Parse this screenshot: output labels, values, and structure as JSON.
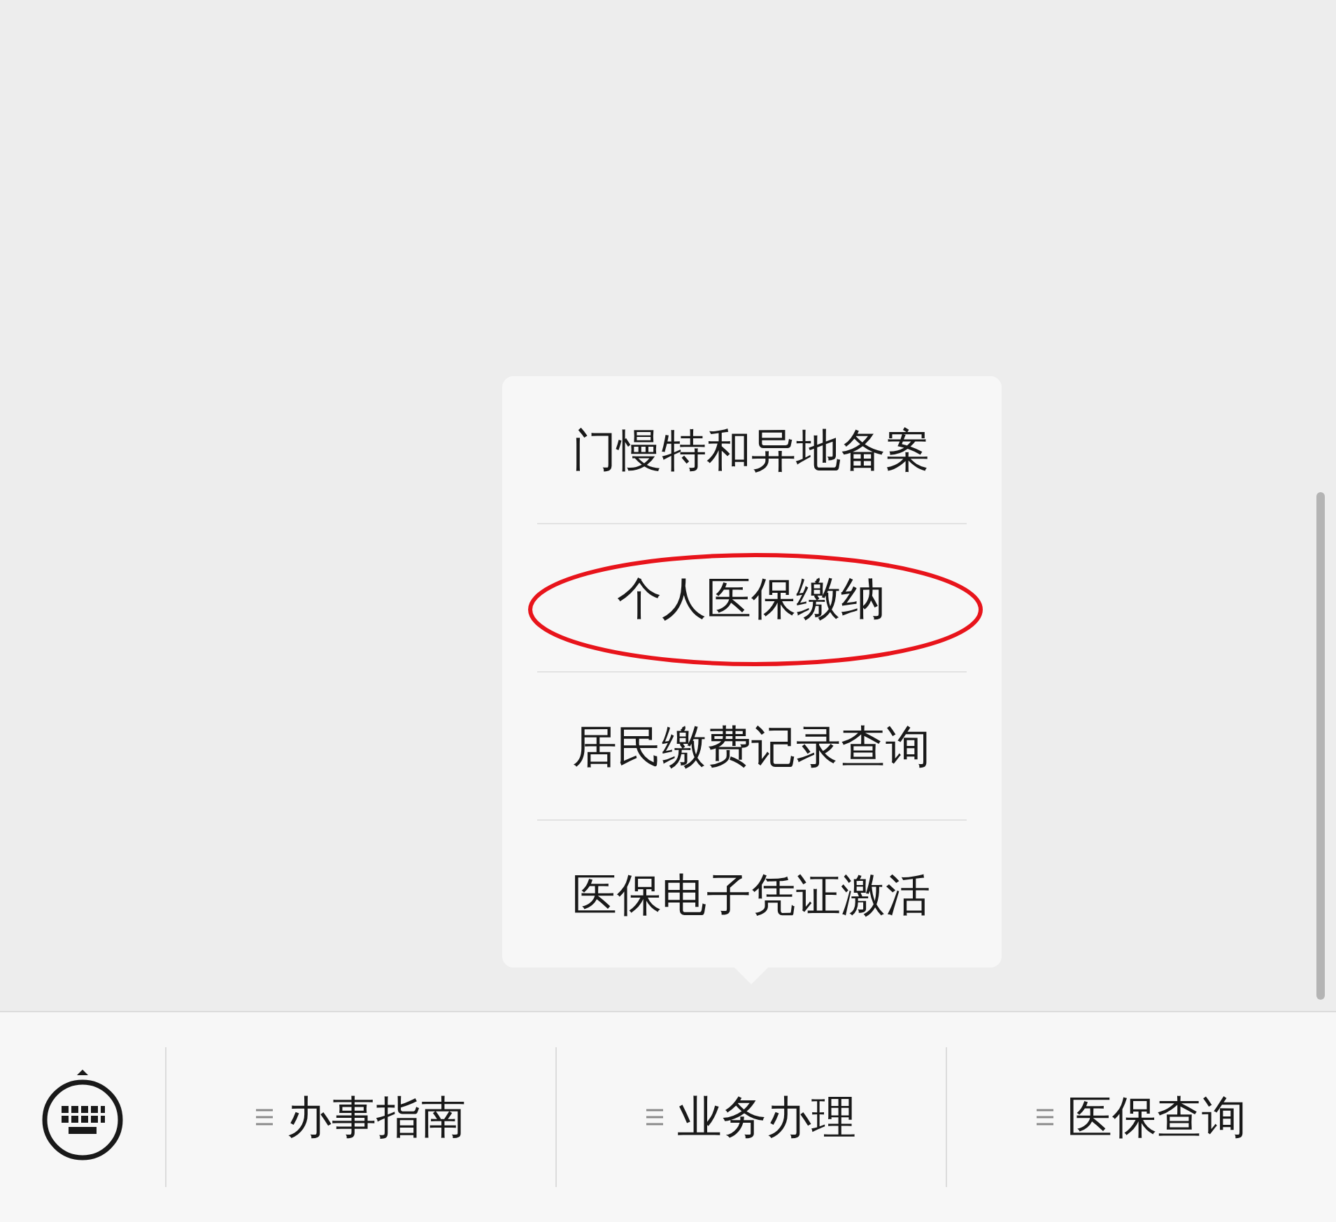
{
  "menu_bar": {
    "items": [
      {
        "label": "办事指南"
      },
      {
        "label": "业务办理",
        "submenu": [
          {
            "label": "门慢特和异地备案",
            "circled": false
          },
          {
            "label": "个人医保缴纳",
            "circled": true
          },
          {
            "label": "居民缴费记录查询",
            "circled": false
          },
          {
            "label": "医保电子凭证激活",
            "circled": false
          }
        ]
      },
      {
        "label": "医保查询"
      }
    ]
  }
}
